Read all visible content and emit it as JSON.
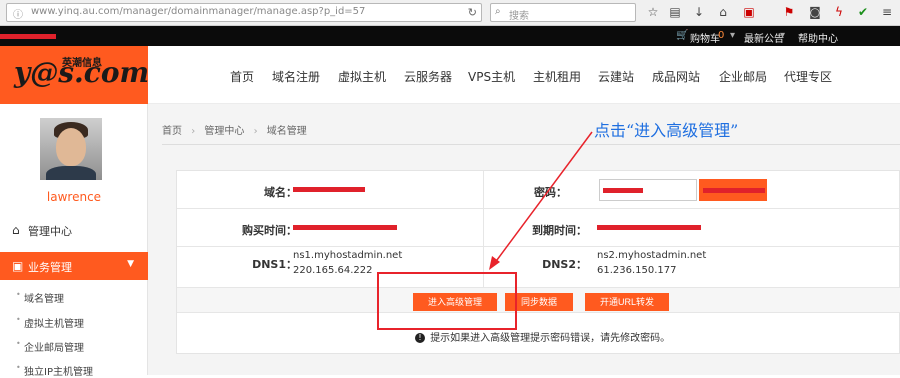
{
  "browser": {
    "url": "www.yinq.au.com/manager/domainmanager/manage.asp?p_id=57",
    "search_placeholder": "搜索"
  },
  "topbar": {
    "cart": "购物车",
    "cart_count": "0",
    "notice": "最新公告",
    "help": "帮助中心"
  },
  "logo": {
    "text": "y@s.com",
    "cn": "英潮信息"
  },
  "nav": [
    "首页",
    "域名注册",
    "虚拟主机",
    "云服务器",
    "VPS主机",
    "主机租用",
    "云建站",
    "成品网站",
    "企业邮局",
    "代理专区"
  ],
  "sidebar": {
    "username": "lawrence",
    "items": [
      {
        "label": "管理中心",
        "icon": "home-icon"
      },
      {
        "label": "业务管理",
        "icon": "briefcase-icon"
      }
    ],
    "subitems": [
      "域名管理",
      "虚拟主机管理",
      "企业邮局管理",
      "独立IP主机管理"
    ]
  },
  "breadcrumb": [
    "首页",
    "管理中心",
    "域名管理"
  ],
  "domain_info": {
    "domain_label": "域名：",
    "password_label": "密码：",
    "buy_time_label": "购买时间：",
    "expire_time_label": "到期时间：",
    "dns1_label": "DNS1：",
    "dns2_label": "DNS2：",
    "dns1_host": "ns1.myhostadmin.net",
    "dns1_ip": "220.165.64.222",
    "dns2_host": "ns2.myhostadmin.net",
    "dns2_ip": "61.236.150.177"
  },
  "buttons": {
    "advanced": "进入高级管理",
    "sync": "同步数据",
    "url_forward": "开通URL转发"
  },
  "note": "提示如果进入高级管理提示密码错误，请先修改密码。",
  "annotation": "点击“进入高级管理”",
  "colors": {
    "brand": "#ff5a1f",
    "annotation": "#1f6fe0",
    "highlight": "#e8232b"
  }
}
